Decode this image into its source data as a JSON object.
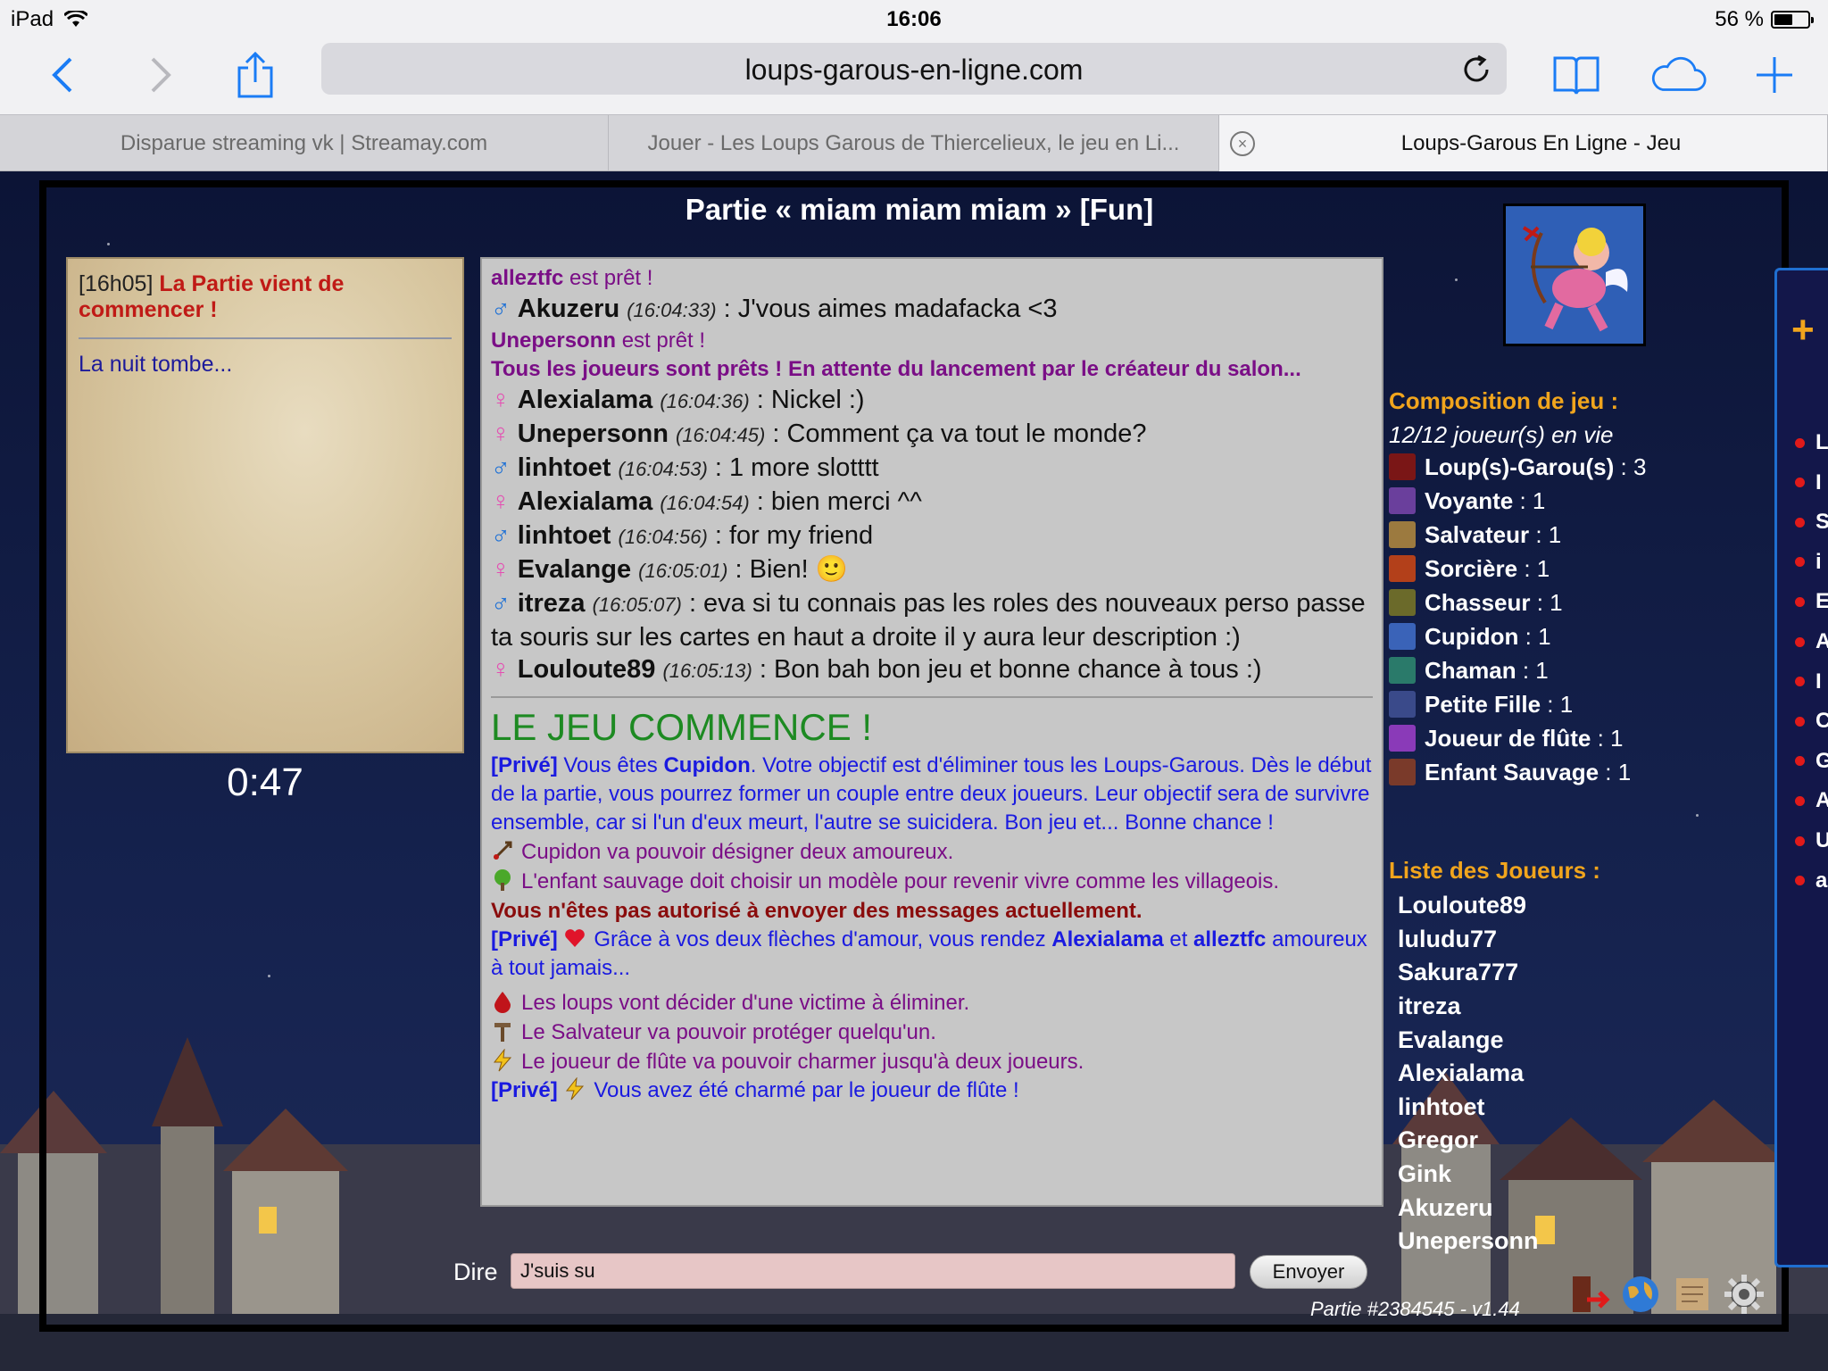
{
  "status_bar": {
    "device": "iPad",
    "time": "16:06",
    "battery": "56 %",
    "battery_level": 0.56
  },
  "browser": {
    "url": "loups-garous-en-ligne.com",
    "tabs": [
      "Disparue streaming vk | Streamay.com",
      "Jouer - Les Loups Garous de Thiercelieux, le jeu en Li...",
      "Loups-Garous En Ligne - Jeu"
    ],
    "active_tab": 2
  },
  "game": {
    "title": "Partie « miam miam miam » [Fun]",
    "log": {
      "time": "[16h05]",
      "message": "La Partie vient de commencer !",
      "night": "La nuit tombe..."
    },
    "timer": "0:47",
    "chat": {
      "ready1": {
        "name": "alleztfc",
        "text": "est prêt !"
      },
      "msg1": {
        "gender": "♂",
        "name": "Akuzeru",
        "time": "(16:04:33)",
        "text": ": J'vous aimes madafacka <3"
      },
      "ready2": {
        "name": "Unepersonn",
        "text": "est prêt !"
      },
      "all_ready": "Tous les joueurs sont prêts ! En attente du lancement par le créateur du salon...",
      "msg2": {
        "gender": "♀",
        "name": "Alexialama",
        "time": "(16:04:36)",
        "text": ": Nickel :)"
      },
      "msg3": {
        "gender": "♀",
        "name": "Unepersonn",
        "time": "(16:04:45)",
        "text": ": Comment ça va tout le monde?"
      },
      "msg4": {
        "gender": "♂",
        "name": "linhtoet",
        "time": "(16:04:53)",
        "text": ": 1 more slotttt"
      },
      "msg5": {
        "gender": "♀",
        "name": "Alexialama",
        "time": "(16:04:54)",
        "text": ": bien merci ^^"
      },
      "msg6": {
        "gender": "♂",
        "name": "linhtoet",
        "time": "(16:04:56)",
        "text": ": for my friend"
      },
      "msg7": {
        "gender": "♀",
        "name": "Evalange",
        "time": "(16:05:01)",
        "text": ": Bien!",
        "emoji": "🙂"
      },
      "msg8": {
        "gender": "♂",
        "name": "itreza",
        "time": "(16:05:07)",
        "text": ": eva si tu connais pas les roles des nouveaux perso passe ta souris sur les cartes en haut a droite il y aura leur description :)"
      },
      "msg9": {
        "gender": "♀",
        "name": "Louloute89",
        "time": "(16:05:13)",
        "text": ": Bon bah bon jeu et bonne chance à tous :)"
      },
      "start": "LE JEU COMMENCE !",
      "priv1": {
        "tag": "[Privé]",
        "pre": "Vous êtes",
        "role": "Cupidon",
        "post": ". Votre objectif est d'éliminer tous les Loups-Garous. Dès le début de la partie, vous pourrez former un couple entre deux joueurs. Leur objectif sera de survivre ensemble, car si l'un d'eux meurt, l'autre se suicidera. Bon jeu et... Bonne chance !"
      },
      "sys1": "Cupidon va pouvoir désigner deux amoureux.",
      "sys2": "L'enfant sauvage doit choisir un modèle pour revenir vivre comme les villageois.",
      "not_allowed": "Vous n'êtes pas autorisé à envoyer des messages actuellement.",
      "priv2": {
        "tag": "[Privé]",
        "pre": "Grâce à vos deux flèches d'amour, vous rendez",
        "p1": "Alexialama",
        "and": "et",
        "p2": "alleztfc",
        "post": "amoureux à tout jamais..."
      },
      "sys3": "Les loups vont décider d'une victime à éliminer.",
      "sys4": "Le Salvateur va pouvoir protéger quelqu'un.",
      "sys5": "Le joueur de flûte va pouvoir charmer jusqu'à deux joueurs.",
      "priv3": {
        "tag": "[Privé]",
        "text": "Vous avez été charmé par le joueur de flûte !"
      }
    },
    "input": {
      "label": "Dire",
      "value": "J'suis su",
      "send": "Envoyer"
    },
    "composition": {
      "title": "Composition de jeu :",
      "alive": "12/12 joueur(s) en vie",
      "roles": [
        {
          "name": "Loup(s)-Garou(s)",
          "count": ": 3",
          "color": "#7a1616"
        },
        {
          "name": "Voyante",
          "count": ": 1",
          "color": "#6a3f9c"
        },
        {
          "name": "Salvateur",
          "count": ": 1",
          "color": "#9c7a3f"
        },
        {
          "name": "Sorcière",
          "count": ": 1",
          "color": "#b3401a"
        },
        {
          "name": "Chasseur",
          "count": ": 1",
          "color": "#6b6a2a"
        },
        {
          "name": "Cupidon",
          "count": ": 1",
          "color": "#3a63b8"
        },
        {
          "name": "Chaman",
          "count": ": 1",
          "color": "#2a7a6a"
        },
        {
          "name": "Petite Fille",
          "count": ": 1",
          "color": "#3a4a8a"
        },
        {
          "name": "Joueur de flûte",
          "count": ": 1",
          "color": "#8a3ab8"
        },
        {
          "name": "Enfant Sauvage",
          "count": ": 1",
          "color": "#7a3a2a"
        }
      ]
    },
    "players": {
      "title": "Liste des Joueurs :",
      "list": [
        "Louloute89",
        "luludu77",
        "Sakura777",
        "itreza",
        "Evalange",
        "Alexialama",
        "linhtoet",
        "Gregor",
        "Gink",
        "Akuzeru",
        "Unepersonn"
      ]
    },
    "version": "Partie #2384545 - v1.44",
    "side_panel": {
      "plus": "+",
      "letters": [
        "L",
        "I",
        "S",
        "i",
        "E",
        "A",
        "I",
        "C",
        "G",
        "A",
        "U",
        "a"
      ]
    }
  }
}
